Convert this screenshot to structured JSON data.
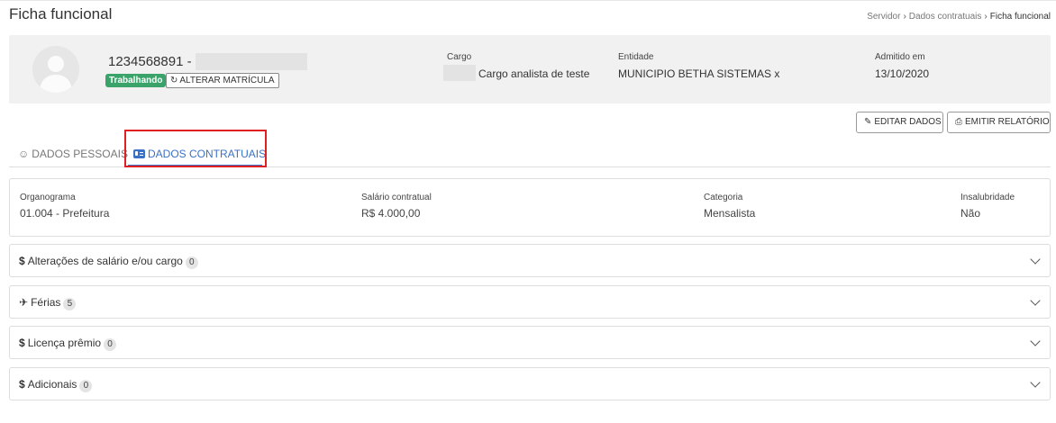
{
  "header": {
    "title": "Ficha funcional",
    "breadcrumb": [
      "Servidor",
      "Dados contratuais",
      "Ficha funcional"
    ]
  },
  "profile": {
    "matricula": "1234568891 - ",
    "status_badge": "Trabalhando",
    "alterar_matricula_label": "ALTERAR MATRÍCULA",
    "cargo_label": "Cargo",
    "cargo_value": "Cargo analista de teste",
    "entidade_label": "Entidade",
    "entidade_value": "MUNICIPIO BETHA SISTEMAS x",
    "admitido_label": "Admitido em",
    "admitido_value": "13/10/2020"
  },
  "actions": {
    "editar_label": "EDITAR DADOS",
    "emitir_label": "EMITIR RELATÓRIO"
  },
  "tabs": [
    {
      "label": "DADOS PESSOAIS",
      "active": false
    },
    {
      "label": "DADOS CONTRATUAIS",
      "active": true
    }
  ],
  "contract_info": [
    {
      "label": "Organograma",
      "value": "01.004 - Prefeitura"
    },
    {
      "label": "Salário contratual",
      "value": "R$ 4.000,00"
    },
    {
      "label": "Categoria",
      "value": "Mensalista"
    },
    {
      "label": "Insalubridade",
      "value": "Não"
    }
  ],
  "sections": [
    {
      "title": "Alterações de salário e/ou cargo",
      "count": "0",
      "icon": "dollar-icon"
    },
    {
      "title": "Férias",
      "count": "5",
      "icon": "plane-icon"
    },
    {
      "title": "Licença prêmio",
      "count": "0",
      "icon": "dollar-icon"
    },
    {
      "title": "Adicionais",
      "count": "0",
      "icon": "dollar-icon"
    }
  ],
  "colors": {
    "accent": "#3a71c6",
    "status_green": "#3aa36a",
    "highlight_red": "#e02020"
  }
}
